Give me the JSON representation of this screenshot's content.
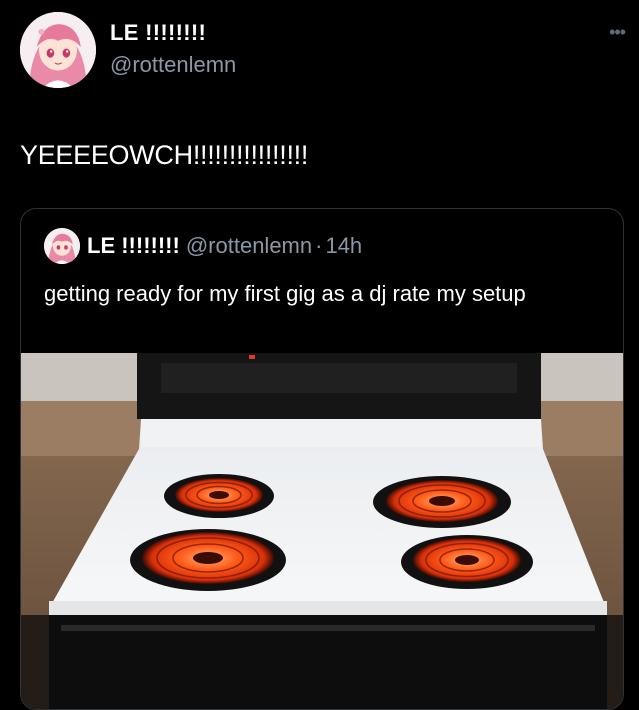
{
  "tweet": {
    "display_name": "LE !!!!!!!!",
    "handle": "@rottenlemn",
    "more_icon": "more-dots-icon",
    "text": "YEEEEOWCH!!!!!!!!!!!!!!!!"
  },
  "quoted_tweet": {
    "display_name": "LE !!!!!!!!",
    "handle": "@rottenlemn",
    "separator": "·",
    "time": "14h",
    "text": "getting ready for my first gig as a dj rate my setup",
    "image": "white-electric-stove-with-glowing-burners"
  },
  "colors": {
    "background": "#000000",
    "text_primary": "#e7e9ea",
    "text_secondary": "#8b98a5",
    "border": "#2f3336",
    "burner_glow": "#ff4a12"
  }
}
